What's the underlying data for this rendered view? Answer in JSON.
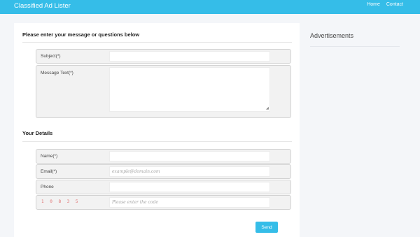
{
  "header": {
    "brand": "Classified Ad Lister",
    "nav": [
      "Home",
      "Contact"
    ]
  },
  "message_section": {
    "title": "Please enter your message or questions below",
    "subject_label": "Subject(*)",
    "subject_value": "",
    "message_label": "Message Text(*)",
    "message_value": ""
  },
  "details_section": {
    "title": "Your Details",
    "name_label": "Name(*)",
    "name_value": "",
    "email_label": "Email(*)",
    "email_placeholder": "example@domain.com",
    "phone_label": "Phone",
    "phone_value": "",
    "captcha_text": "1 0 8 3 5",
    "captcha_placeholder": "Please enter the code"
  },
  "actions": {
    "send_label": "Send"
  },
  "sidebar": {
    "title": "Advertisements"
  },
  "colors": {
    "accent": "#35bde8",
    "captcha": "#e07070"
  }
}
